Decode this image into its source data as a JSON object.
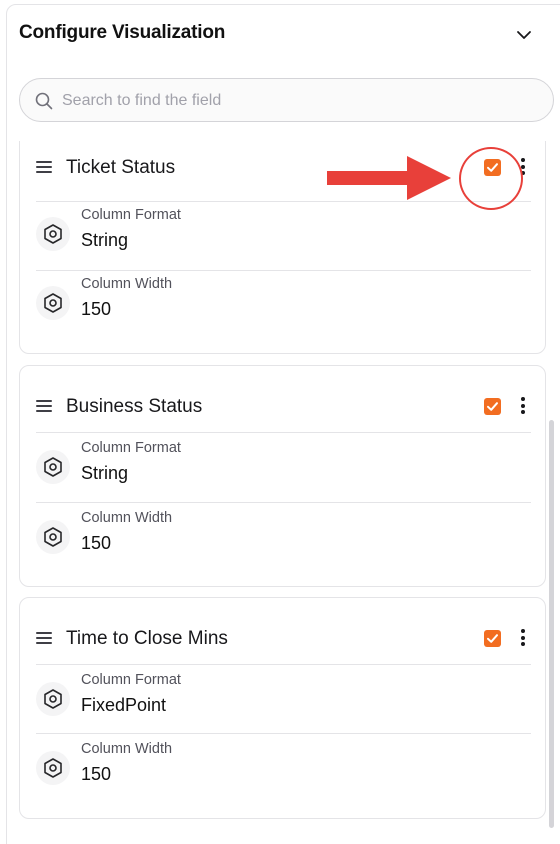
{
  "panel": {
    "title": "Configure Visualization",
    "collapse_icon": "chevron-down-icon"
  },
  "search": {
    "placeholder": "Search to find the field",
    "value": "",
    "icon": "search-icon"
  },
  "fields": [
    {
      "name": "Ticket Status",
      "checked": true,
      "properties": [
        {
          "label": "Column Format",
          "value": "String"
        },
        {
          "label": "Column Width",
          "value": "150"
        }
      ]
    },
    {
      "name": "Business Status",
      "checked": true,
      "properties": [
        {
          "label": "Column Format",
          "value": "String"
        },
        {
          "label": "Column Width",
          "value": "150"
        }
      ]
    },
    {
      "name": "Time to Close Mins",
      "checked": true,
      "properties": [
        {
          "label": "Column Format",
          "value": "FixedPoint"
        },
        {
          "label": "Column Width",
          "value": "150"
        }
      ]
    }
  ],
  "colors": {
    "accent": "#f26d21",
    "annotation": "#e8403a",
    "border": "#e4e4e7"
  }
}
